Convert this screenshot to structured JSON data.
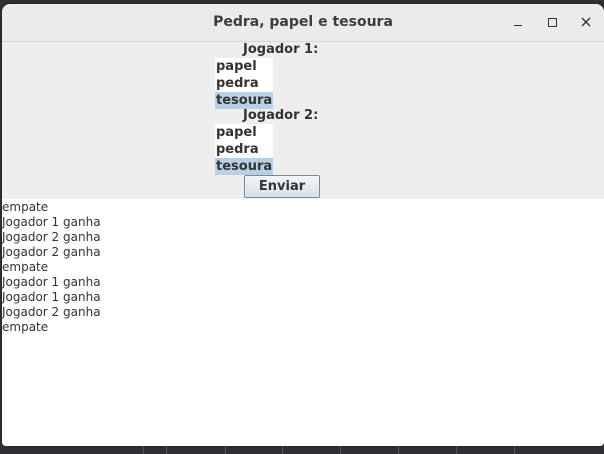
{
  "window": {
    "title": "Pedra, papel e tesoura"
  },
  "icons": {
    "minimize": "minimize-icon",
    "maximize": "maximize-icon",
    "close": "close-icon"
  },
  "player1": {
    "label": "Jogador 1:",
    "options": [
      "papel",
      "pedra",
      "tesoura"
    ],
    "selected": "tesoura"
  },
  "player2": {
    "label": "Jogador 2:",
    "options": [
      "papel",
      "pedra",
      "tesoura"
    ],
    "selected": "tesoura"
  },
  "send_button": {
    "label": "Enviar"
  },
  "results": [
    "empate",
    "Jogador 1 ganha",
    "Jogador 2 ganha",
    "Jogador 2 ganha",
    "empate",
    "Jogador 1 ganha",
    "Jogador 1 ganha",
    "Jogador 2 ganha",
    "empate"
  ],
  "colors": {
    "selection": "#b8cfe5",
    "panel_background": "#eeeeee",
    "titlebar_background": "#ebebeb"
  }
}
